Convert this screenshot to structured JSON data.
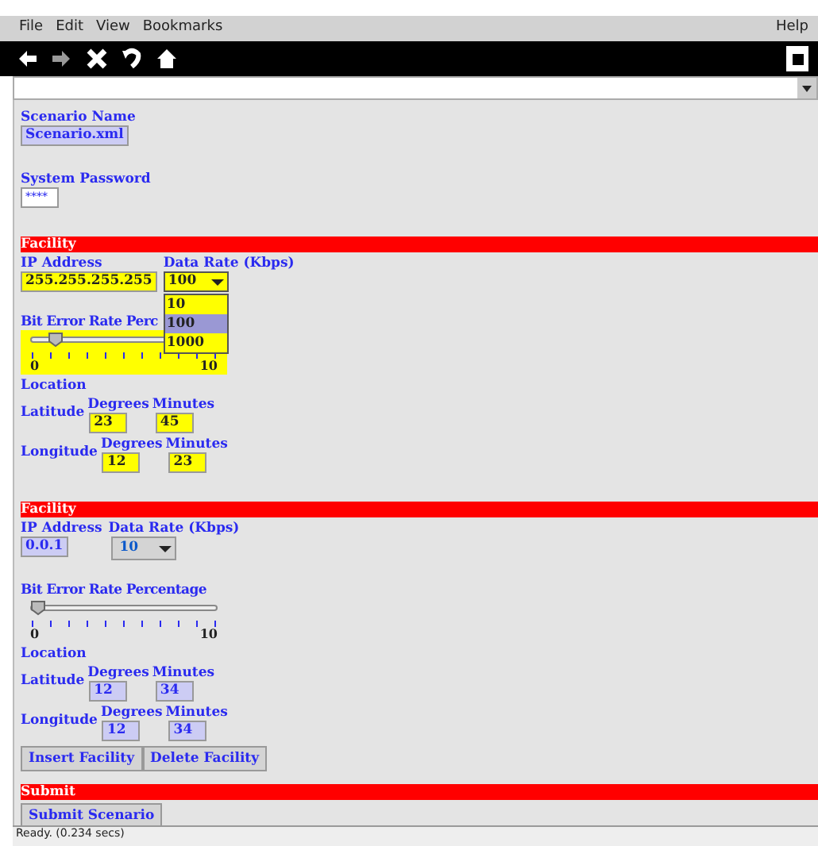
{
  "menu": [
    "File",
    "Edit",
    "View",
    "Bookmarks"
  ],
  "help_menu": "Help",
  "scenario": {
    "label": "Scenario Name",
    "value": "Scenario.xml"
  },
  "password": {
    "label": "System Password",
    "value": "****"
  },
  "facilities": [
    {
      "title": "Facility",
      "highlighted": true,
      "ip_label": "IP Address",
      "ip": "255.255.255.255",
      "rate_label": "Data Rate (Kbps)",
      "rate": "100",
      "open": true,
      "options": [
        {
          "label": "10",
          "selected": false
        },
        {
          "label": "100",
          "selected": true
        },
        {
          "label": "1000",
          "selected": false
        }
      ],
      "ber_label": "Bit Error Rate Perc",
      "level": 0.1,
      "min": "0",
      "max": "10",
      "location_label": "Location",
      "latitude": {
        "label": "Latitude",
        "degrees_label": "Degrees",
        "minutes_label": "Minutes",
        "degrees": "23",
        "minutes": "45"
      },
      "longitude": {
        "label": "Longitude",
        "degrees_label": "Degrees",
        "minutes_label": "Minutes",
        "degrees": "12",
        "minutes": "23"
      }
    },
    {
      "title": "Facility",
      "highlighted": false,
      "ip_label": "IP Address",
      "ip": "0.0.1",
      "rate_label": "Data Rate (Kbps)",
      "rate": "10",
      "open": false,
      "ber_label": "Bit Error Rate Percentage",
      "level": 0,
      "min": "0",
      "max": "10",
      "location_label": "Location",
      "latitude": {
        "label": "Latitude",
        "degrees_label": "Degrees",
        "minutes_label": "Minutes",
        "degrees": "12",
        "minutes": "34"
      },
      "longitude": {
        "label": "Longitude",
        "degrees_label": "Degrees",
        "minutes_label": "Minutes",
        "degrees": "12",
        "minutes": "34"
      }
    }
  ],
  "facility_buttons": [
    "Insert Facility",
    "Delete Facility"
  ],
  "submit": {
    "title": "Submit",
    "button": "Submit Scenario"
  },
  "status": "Ready. (0.234 secs)"
}
